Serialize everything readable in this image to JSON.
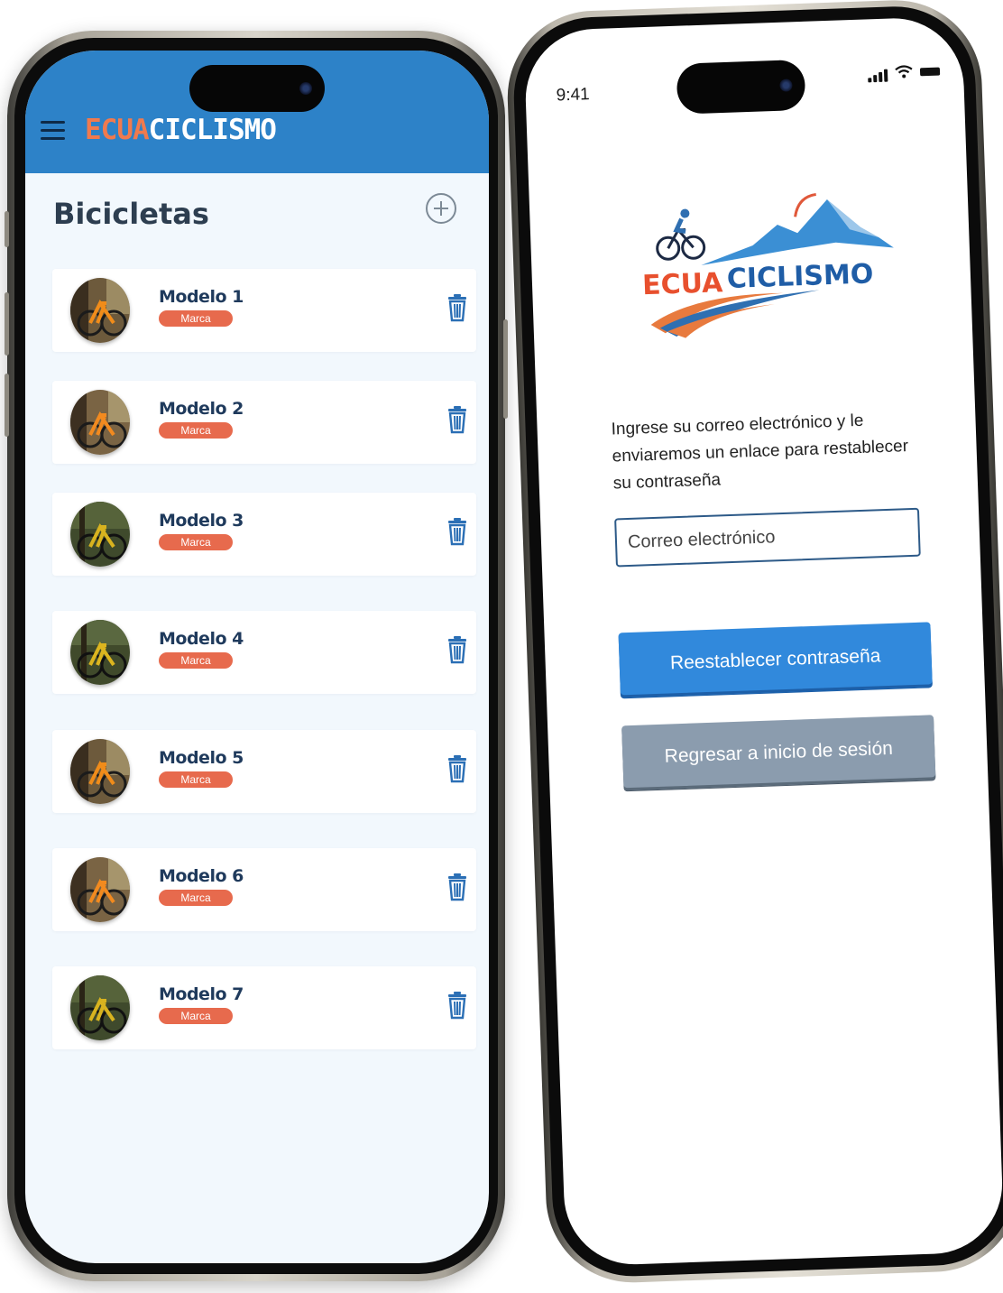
{
  "left_phone": {
    "brand": {
      "part1": "ECUA",
      "part2": "CICLISMO"
    },
    "page_title": "Bicicletas",
    "icons": {
      "menu": "menu-icon",
      "add": "plus-circle-icon",
      "delete": "trash-icon"
    },
    "items": [
      {
        "title": "Modelo 1",
        "badge": "Marca"
      },
      {
        "title": "Modelo 2",
        "badge": "Marca"
      },
      {
        "title": "Modelo 3",
        "badge": "Marca"
      },
      {
        "title": "Modelo 4",
        "badge": "Marca"
      },
      {
        "title": "Modelo 5",
        "badge": "Marca"
      },
      {
        "title": "Modelo 6",
        "badge": "Marca"
      },
      {
        "title": "Modelo 7",
        "badge": "Marca"
      }
    ]
  },
  "right_phone": {
    "status_time": "9:41",
    "logo_text": {
      "part1": "ECUA",
      "part2": "CICLISMO"
    },
    "description": "Ingrese su correo electrónico y le enviaremos un enlace para restablecer su contraseña",
    "email_placeholder": "Correo electrónico",
    "reset_button": "Reestablecer contraseña",
    "back_button": "Regresar a inicio de sesión"
  },
  "colors": {
    "header_blue": "#2d82c8",
    "brand_orange": "#f07a4e",
    "badge_red": "#e76a4d",
    "primary_button": "#3189dc",
    "secondary_button": "#8b9cae",
    "list_background": "#f2f8fd"
  }
}
